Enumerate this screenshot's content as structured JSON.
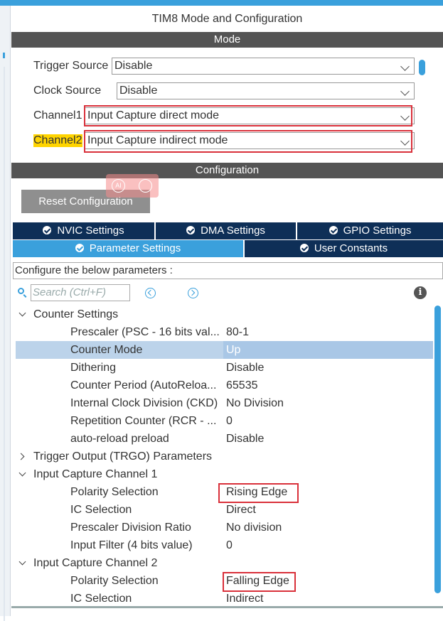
{
  "window": {
    "title": "TIM8 Mode and Configuration"
  },
  "mode": {
    "header": "Mode",
    "fields": [
      {
        "label": "Trigger Source",
        "value": "Disable"
      },
      {
        "label": "Clock Source",
        "value": "Disable"
      },
      {
        "label": "Channel1",
        "value": "Input Capture direct mode"
      },
      {
        "label": "Channel2",
        "value": "Input Capture indirect mode"
      }
    ]
  },
  "configuration": {
    "header": "Configuration",
    "reset_label": "Reset Configuration",
    "tabs": [
      {
        "label": "NVIC Settings"
      },
      {
        "label": "DMA Settings"
      },
      {
        "label": "GPIO Settings"
      },
      {
        "label": "Parameter Settings"
      },
      {
        "label": "User Constants"
      }
    ],
    "configure_text": "Configure the below parameters :",
    "search_placeholder": "Search (Ctrl+F)",
    "groups": [
      {
        "name": "Counter Settings",
        "params": [
          {
            "key": "Prescaler (PSC - 16 bits val...",
            "value": "80-1"
          },
          {
            "key": "Counter Mode",
            "value": "Up"
          },
          {
            "key": "Dithering",
            "value": "Disable"
          },
          {
            "key": "Counter Period (AutoReloa...",
            "value": "65535"
          },
          {
            "key": "Internal Clock Division (CKD)",
            "value": "No Division"
          },
          {
            "key": "Repetition Counter (RCR - ...",
            "value": "0"
          },
          {
            "key": "auto-reload preload",
            "value": "Disable"
          }
        ]
      },
      {
        "name": "Trigger Output (TRGO) Parameters",
        "params": []
      },
      {
        "name": "Input Capture Channel 1",
        "params": [
          {
            "key": "Polarity Selection",
            "value": "Rising Edge"
          },
          {
            "key": "IC Selection",
            "value": "Direct"
          },
          {
            "key": "Prescaler Division Ratio",
            "value": "No division"
          },
          {
            "key": "Input Filter (4 bits value)",
            "value": "0"
          }
        ]
      },
      {
        "name": "Input Capture Channel 2",
        "params": [
          {
            "key": "Polarity Selection",
            "value": "Falling Edge"
          },
          {
            "key": "IC Selection",
            "value": "Indirect"
          }
        ]
      }
    ]
  },
  "colors": {
    "accent": "#3aa0dc",
    "tab_dark": "#0e2f57",
    "header_bar": "#545454",
    "highlight_box": "#d9303a",
    "label_highlight": "#ffd400"
  }
}
